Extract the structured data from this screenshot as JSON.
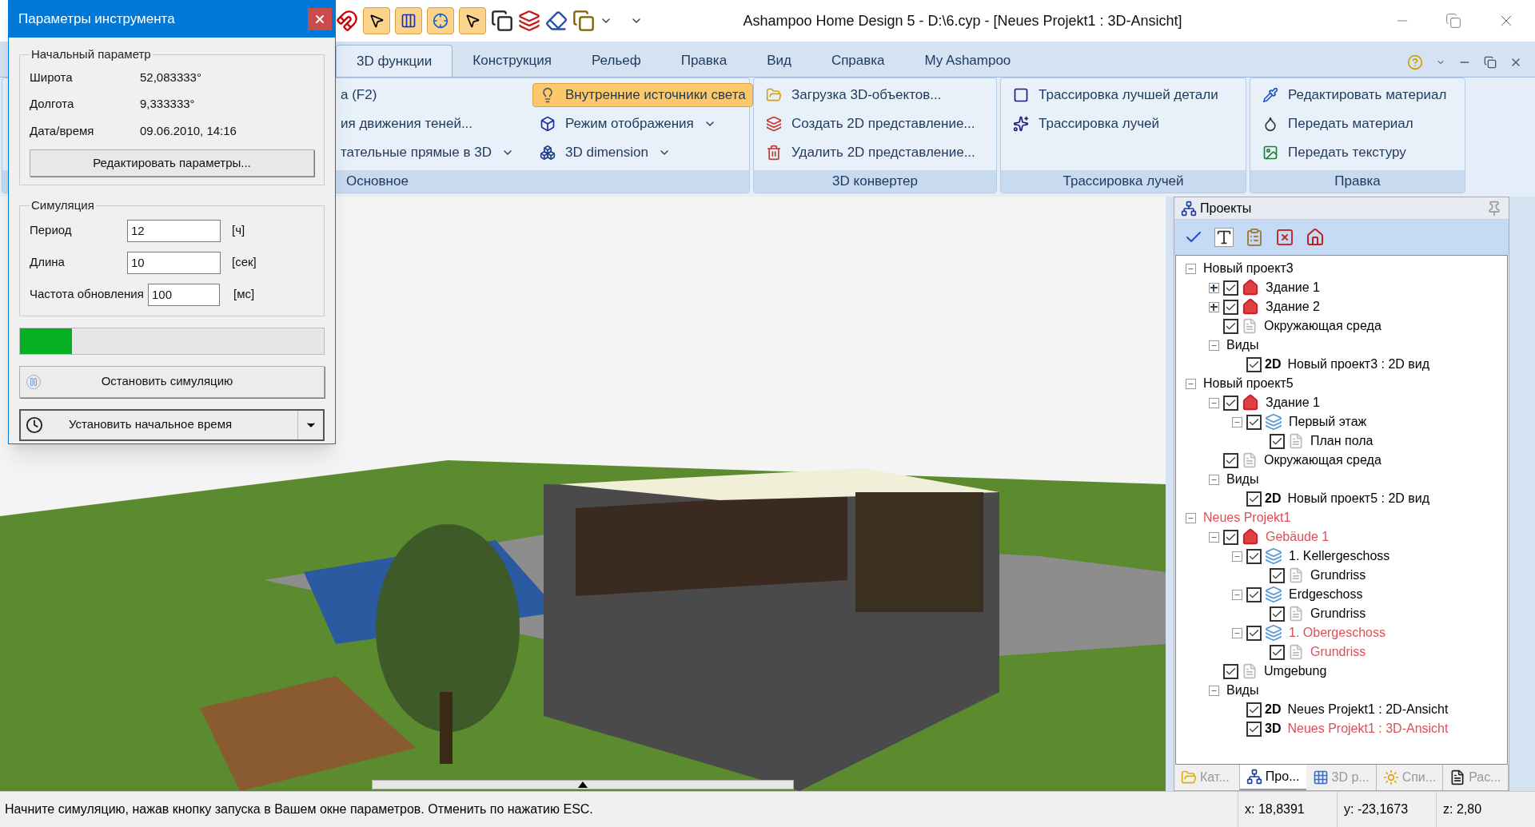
{
  "window": {
    "title": "Ashampoo Home Design 5 - D:\\6.cyp - [Neues Projekt1 : 3D-Ansicht]"
  },
  "tabs": [
    {
      "label": "3D функции",
      "selected": true
    },
    {
      "label": "Конструкция",
      "selected": false
    },
    {
      "label": "Рельеф",
      "selected": false
    },
    {
      "label": "Правка",
      "selected": false
    },
    {
      "label": "Вид",
      "selected": false
    },
    {
      "label": "Справка",
      "selected": false
    },
    {
      "label": "My Ashampoo",
      "selected": false
    }
  ],
  "ribbon_groups": [
    {
      "label": "Основное",
      "columns": [
        [
          {
            "label": "а (F2)",
            "dropdown": false,
            "on": false
          },
          {
            "label": "ия движения теней...",
            "dropdown": false,
            "on": false
          },
          {
            "label": "тательные прямые в 3D",
            "dropdown": true,
            "on": false
          }
        ],
        [
          {
            "label": "Внутренние источники света",
            "dropdown": false,
            "on": true
          },
          {
            "label": "Режим отображения",
            "dropdown": true,
            "on": false
          },
          {
            "label": "3D dimension",
            "dropdown": true,
            "on": false
          }
        ]
      ]
    },
    {
      "label": "3D конвертер",
      "columns": [
        [
          {
            "label": "Загрузка 3D-объектов...",
            "dropdown": false,
            "on": false
          },
          {
            "label": "Создать 2D представление...",
            "dropdown": false,
            "on": false
          },
          {
            "label": "Удалить 2D представление...",
            "dropdown": false,
            "on": false
          }
        ]
      ]
    },
    {
      "label": "Трассировка лучей",
      "columns": [
        [
          {
            "label": "Трассировка лучшей детали",
            "dropdown": false,
            "on": false
          },
          {
            "label": "Трассировка лучей",
            "dropdown": false,
            "on": false
          }
        ]
      ]
    },
    {
      "label": "Правка",
      "columns": [
        [
          {
            "label": "Редактировать материал",
            "dropdown": false,
            "on": false
          },
          {
            "label": "Передать материал",
            "dropdown": false,
            "on": false
          },
          {
            "label": "Передать текстуру",
            "dropdown": false,
            "on": false
          }
        ]
      ]
    }
  ],
  "dialog": {
    "title": "Параметры инструмента",
    "start_group": {
      "title": "Начальный параметр",
      "rows": [
        {
          "label": "Широта",
          "value": "52,083333°"
        },
        {
          "label": "Долгота",
          "value": "9,333333°"
        },
        {
          "label": "Дата/время",
          "value": "09.06.2010, 14:16"
        }
      ],
      "button": "Редактировать параметры..."
    },
    "simulation_group": {
      "title": "Симуляция",
      "fields": [
        {
          "label": "Период",
          "value": "12",
          "unit": "[ч]"
        },
        {
          "label": "Длина",
          "value": "10",
          "unit": "[сек]"
        },
        {
          "label": "Частота обновления",
          "value": "100",
          "unit": "[мс]"
        }
      ]
    },
    "progress": {
      "level": 0.17
    },
    "stop_button": "Остановить симуляцию",
    "start_time_button": "Установить начальное время"
  },
  "projects_panel": {
    "title": "Проекты",
    "tree": [
      {
        "label": "Новый проект3",
        "expanded": true,
        "active": false,
        "children": [
          {
            "label": "Здание 1",
            "kind": "building",
            "expanded": false,
            "checked": true,
            "active": false
          },
          {
            "label": "Здание 2",
            "kind": "building",
            "expanded": false,
            "checked": true,
            "active": false
          },
          {
            "label": "Окружающая среда",
            "kind": "page",
            "checked": true,
            "active": false
          },
          {
            "label": "Виды",
            "expanded": true,
            "active": false,
            "children": [
              {
                "label": "Новый проект3 : 2D вид",
                "kind": "view",
                "badge": "2D",
                "checked": true,
                "active": false
              }
            ]
          }
        ]
      },
      {
        "label": "Новый проект5",
        "expanded": true,
        "active": false,
        "children": [
          {
            "label": "Здание 1",
            "kind": "building",
            "expanded": true,
            "checked": true,
            "active": false,
            "children": [
              {
                "label": "Первый этаж",
                "kind": "floor",
                "expanded": true,
                "checked": true,
                "active": false,
                "children": [
                  {
                    "label": "План пола",
                    "kind": "page",
                    "checked": true,
                    "active": false
                  }
                ]
              }
            ]
          },
          {
            "label": "Окружающая среда",
            "kind": "page",
            "checked": true,
            "active": false
          },
          {
            "label": "Виды",
            "expanded": true,
            "active": false,
            "children": [
              {
                "label": "Новый проект5 : 2D вид",
                "kind": "view",
                "badge": "2D",
                "checked": true,
                "active": false
              }
            ]
          }
        ]
      },
      {
        "label": "Neues Projekt1",
        "expanded": true,
        "active": true,
        "children": [
          {
            "label": "Gebäude 1",
            "kind": "building",
            "expanded": true,
            "checked": true,
            "active": true,
            "children": [
              {
                "label": "1. Kellergeschoss",
                "kind": "floor",
                "expanded": true,
                "checked": true,
                "active": false,
                "children": [
                  {
                    "label": "Grundriss",
                    "kind": "page",
                    "checked": true,
                    "active": false
                  }
                ]
              },
              {
                "label": "Erdgeschoss",
                "kind": "floor",
                "expanded": true,
                "checked": true,
                "active": false,
                "children": [
                  {
                    "label": "Grundriss",
                    "kind": "page",
                    "checked": true,
                    "active": false
                  }
                ]
              },
              {
                "label": "1. Obergeschoss",
                "kind": "floor",
                "expanded": true,
                "checked": true,
                "active": true,
                "children": [
                  {
                    "label": "Grundriss",
                    "kind": "page",
                    "checked": true,
                    "active": true
                  }
                ]
              }
            ]
          },
          {
            "label": "Umgebung",
            "kind": "page",
            "checked": true,
            "active": false
          },
          {
            "label": "Виды",
            "expanded": true,
            "active": false,
            "children": [
              {
                "label": "Neues Projekt1 : 2D-Ansicht",
                "kind": "view",
                "badge": "2D",
                "checked": true,
                "active": false
              },
              {
                "label": "Neues Projekt1 : 3D-Ansicht",
                "kind": "view",
                "badge": "3D",
                "checked": true,
                "active": true
              }
            ]
          }
        ]
      }
    ],
    "bottom_tabs": [
      {
        "label": "Кат...",
        "selected": false
      },
      {
        "label": "Про...",
        "selected": true
      },
      {
        "label": "3D р...",
        "selected": false
      },
      {
        "label": "Спи...",
        "selected": false
      },
      {
        "label": "Рас...",
        "selected": false
      }
    ]
  },
  "status_bar": {
    "message": "Начните симуляцию, нажав кнопку запуска в Вашем окне параметров. Отменить по нажатию ESC.",
    "coords": [
      "x: 18,8391",
      "y: -23,1673",
      "z: 2,80"
    ]
  }
}
